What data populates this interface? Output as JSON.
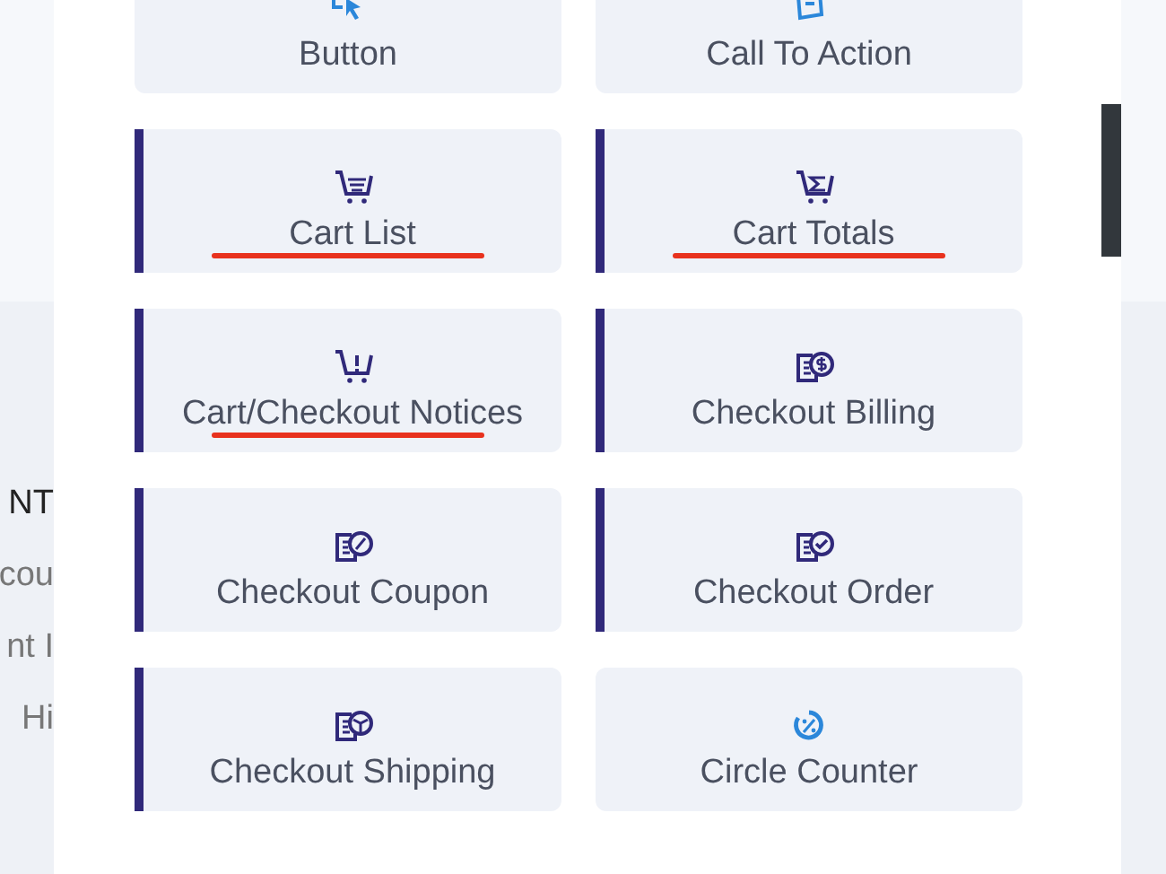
{
  "background_texts": [
    "NT",
    "cou",
    "nt I",
    "Hi"
  ],
  "modules": [
    {
      "label": "Button",
      "kind": "cursor",
      "accent": false,
      "underlined": false
    },
    {
      "label": "Call To Action",
      "kind": "cta",
      "accent": false,
      "underlined": false
    },
    {
      "label": "Cart List",
      "kind": "cart-list",
      "accent": true,
      "underlined": true
    },
    {
      "label": "Cart Totals",
      "kind": "cart-totals",
      "accent": true,
      "underlined": true
    },
    {
      "label": "Cart/Checkout Notices",
      "kind": "cart-notice",
      "accent": true,
      "underlined": true
    },
    {
      "label": "Checkout Billing",
      "kind": "billing",
      "accent": true,
      "underlined": false
    },
    {
      "label": "Checkout Coupon",
      "kind": "coupon",
      "accent": true,
      "underlined": false
    },
    {
      "label": "Checkout Order",
      "kind": "order",
      "accent": true,
      "underlined": false
    },
    {
      "label": "Checkout Shipping",
      "kind": "shipping",
      "accent": true,
      "underlined": false
    },
    {
      "label": "Circle Counter",
      "kind": "counter",
      "accent": false,
      "underlined": false
    }
  ]
}
